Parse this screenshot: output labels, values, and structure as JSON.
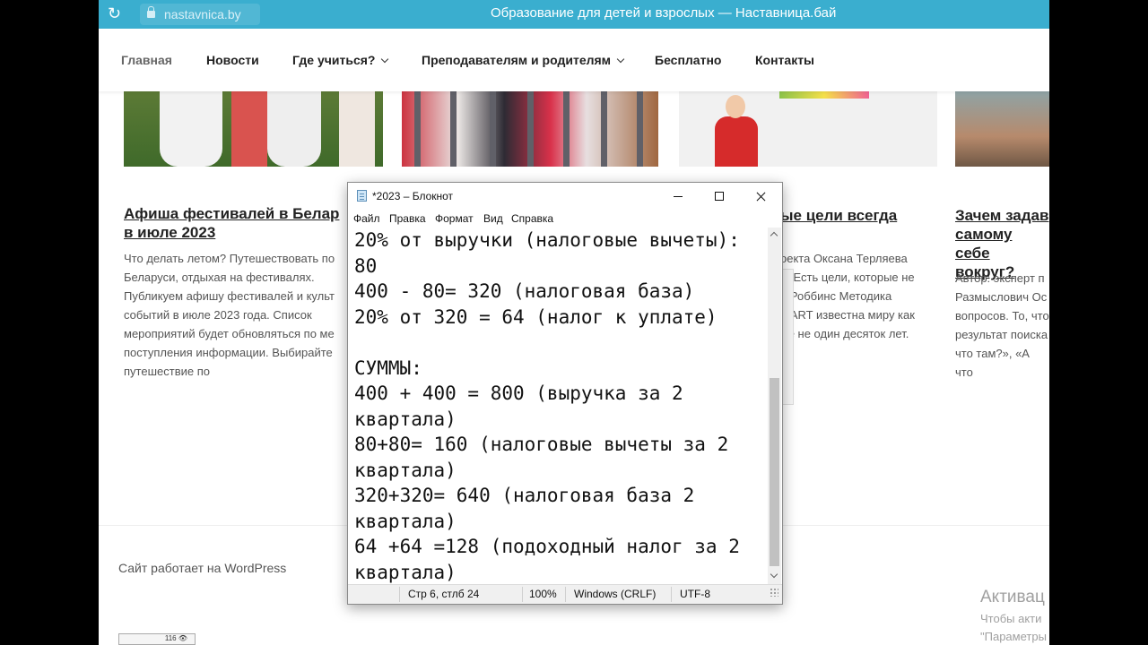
{
  "browser": {
    "url": "nastavnica.by",
    "page_title": "Образование для детей и взрослых — Наставница.бай"
  },
  "nav": {
    "items": [
      {
        "label": "Главная"
      },
      {
        "label": "Новости"
      },
      {
        "label": "Где учиться?"
      },
      {
        "label": "Преподавателям и родителям"
      },
      {
        "label": "Бесплатно"
      },
      {
        "label": "Контакты"
      }
    ]
  },
  "articles": {
    "a1": {
      "title_l1": "Афиша фестивалей в Белар",
      "title_l2": "в июле 2023",
      "text": [
        "Что делать летом? Путешествовать по",
        "Беларуси, отдыхая на фестивалях.",
        "Публикуем афишу фестивалей и культ",
        "событий в июле 2023 года. Список",
        "мероприятий будет обновляться по ме",
        "поступления информации.  Выбирайте",
        "путешествие по"
      ]
    },
    "a3": {
      "title": "ые цели всегда",
      "text": [
        "оекта Оксана Терляева",
        "й. Есть цели, которые не",
        "и Роббинс Методика",
        "MART известна миру как",
        "же не один десяток лет."
      ]
    },
    "a4": {
      "title_l1": "Зачем задав",
      "title_l2": "самому себе",
      "title_l3": "вокруг?",
      "text": [
        "Автор: эксперт п",
        "Размыслович Ос",
        "вопросов. То, что",
        "результат поиска",
        "что там?», «А что"
      ]
    }
  },
  "footer": {
    "text": "Сайт работает на WordPress",
    "counter": "116"
  },
  "watermark": {
    "line1": "Активац",
    "line2": "Чтобы акти",
    "line3": "\"Параметры"
  },
  "notepad": {
    "title": "*2023 – Блокнот",
    "menu": [
      "Файл",
      "Правка",
      "Формат",
      "Вид",
      "Справка"
    ],
    "lines": [
      "20% от выручки (налоговые вычеты):",
      "80",
      "400 - 80= 320 (налоговая база)",
      "20% от 320 = 64 (налог к уплате)",
      "",
      "СУММЫ:",
      "400 + 400 = 800 (выручка за 2",
      "квартала)",
      "80+80= 160 (налоговые вычеты за 2",
      "квартала)",
      "320+320= 640 (налоговая база 2",
      "квартала)",
      "64 +64 =128 (подоходный налог за 2",
      "квартала)"
    ],
    "status": {
      "position": "Стр 6, стлб 24",
      "zoom": "100%",
      "line_ending": "Windows (CRLF)",
      "encoding": "UTF-8"
    }
  }
}
